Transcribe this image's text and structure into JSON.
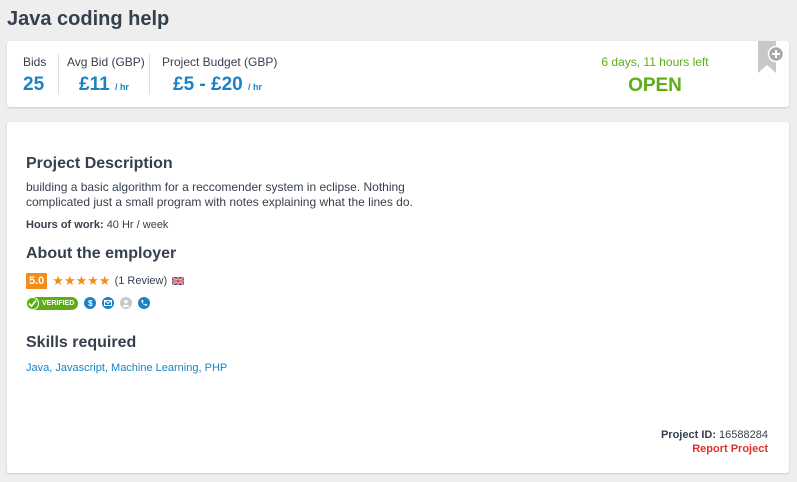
{
  "page": {
    "title": "Java coding help"
  },
  "stats": {
    "bids_label": "Bids",
    "bids_value": "25",
    "avg_bid_label": "Avg Bid (GBP)",
    "avg_bid_value": "£11",
    "avg_bid_unit": "/ hr",
    "budget_label": "Project Budget (GBP)",
    "budget_value": "£5 - £20",
    "budget_unit": "/ hr",
    "time_left": "6 days, 11 hours left",
    "status": "OPEN"
  },
  "description": {
    "title": "Project Description",
    "text": "building a basic algorithm for a reccomender system in eclipse. Nothing complicated just a small program with notes explaining what the lines do.",
    "hours_label": "Hours of work:",
    "hours_value": "40 Hr / week"
  },
  "employer": {
    "title": "About the employer",
    "rating": "5.0",
    "stars": "★★★★★",
    "reviews": "(1 Review)",
    "verified_label": "VERIFIED",
    "verification_icons": [
      "payment-verified-icon",
      "email-verified-icon",
      "profile-icon",
      "phone-verified-icon"
    ]
  },
  "skills": {
    "title": "Skills required",
    "items": [
      "Java",
      "Javascript",
      "Machine Learning",
      "PHP"
    ]
  },
  "footer": {
    "project_id_label": "Project ID:",
    "project_id_value": "16588284",
    "report_label": "Report Project"
  },
  "colors": {
    "accent_blue": "#1a83c6",
    "open_green": "#5dae16",
    "rating_orange": "#f28d1a",
    "report_red": "#e0302a"
  }
}
